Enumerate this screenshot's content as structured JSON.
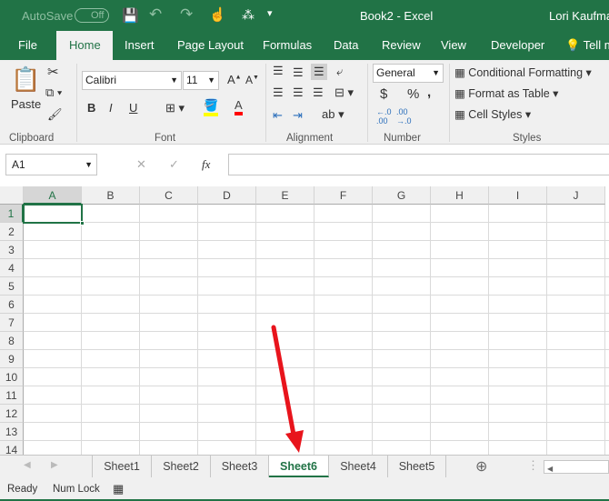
{
  "title_bar": {
    "autosave": "AutoSave",
    "autosave_state": "Off",
    "doc_title": "Book2  -  Excel",
    "user": "Lori Kaufman"
  },
  "tabs": [
    "File",
    "Home",
    "Insert",
    "Page Layout",
    "Formulas",
    "Data",
    "Review",
    "View",
    "Developer",
    "Tell me"
  ],
  "active_tab": "Home",
  "ribbon": {
    "clipboard": {
      "paste": "Paste",
      "label": "Clipboard"
    },
    "font": {
      "name": "Calibri",
      "size": "11",
      "bold": "B",
      "italic": "I",
      "underline": "U",
      "label": "Font",
      "highlight_color": "#ffff00",
      "font_color": "#ff0000"
    },
    "alignment": {
      "label": "Alignment"
    },
    "number": {
      "format": "General",
      "currency": "$",
      "percent": "%",
      "comma": ",",
      "label": "Number"
    },
    "styles": {
      "conditional": "Conditional Formatting",
      "format_table": "Format as Table",
      "cell_styles": "Cell Styles",
      "label": "Styles"
    }
  },
  "formula_bar": {
    "name_box": "A1",
    "fx": "fx",
    "value": ""
  },
  "columns": [
    "A",
    "B",
    "C",
    "D",
    "E",
    "F",
    "G",
    "H",
    "I",
    "J"
  ],
  "rows": [
    "1",
    "2",
    "3",
    "4",
    "5",
    "6",
    "7",
    "8",
    "9",
    "10",
    "11",
    "12",
    "13",
    "14"
  ],
  "selected_cell": "A1",
  "sheet_tabs": [
    "Sheet1",
    "Sheet2",
    "Sheet3",
    "Sheet6",
    "Sheet4",
    "Sheet5"
  ],
  "active_sheet": "Sheet6",
  "status": {
    "ready": "Ready",
    "numlock": "Num Lock"
  },
  "colors": {
    "accent": "#217346",
    "arrow": "#e8141c"
  }
}
